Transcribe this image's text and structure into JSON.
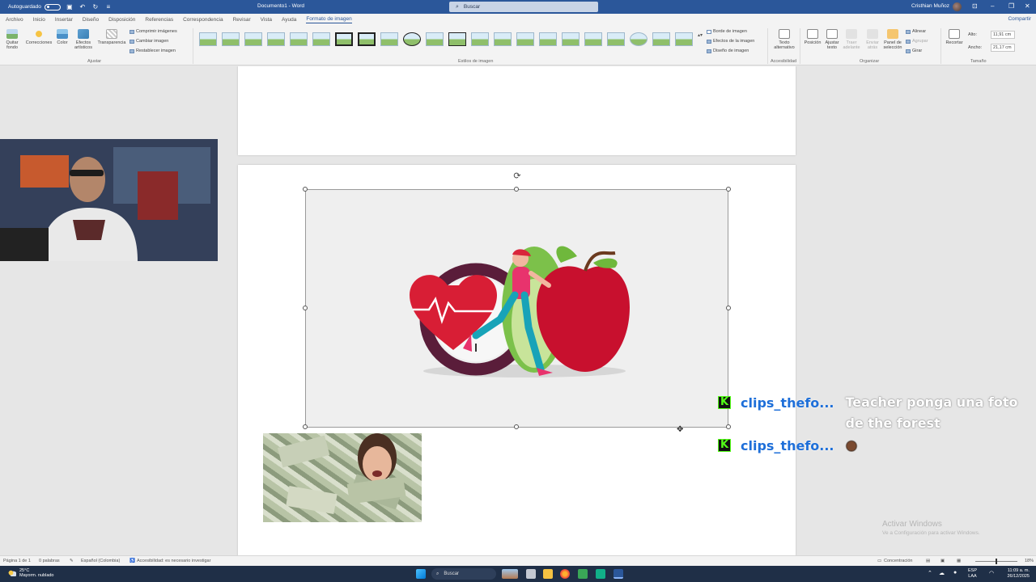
{
  "titlebar": {
    "autosave_label": "Autoguardado",
    "doc_title": "Documento1 - Word",
    "search_placeholder": "Buscar",
    "user_name": "Cristhian Muñoz"
  },
  "tabs": [
    {
      "label": "Archivo"
    },
    {
      "label": "Inicio"
    },
    {
      "label": "Insertar"
    },
    {
      "label": "Diseño"
    },
    {
      "label": "Disposición"
    },
    {
      "label": "Referencias"
    },
    {
      "label": "Correspondencia"
    },
    {
      "label": "Revisar"
    },
    {
      "label": "Vista"
    },
    {
      "label": "Ayuda"
    },
    {
      "label": "Formato de imagen"
    }
  ],
  "share_label": "Compartir",
  "ribbon": {
    "ajustar": {
      "label": "Ajustar",
      "quitar_fondo": "Quitar fondo",
      "correcciones": "Correcciones",
      "color": "Color",
      "efectos": "Efectos artísticos",
      "transparencia": "Transparencia",
      "comprimir": "Comprimir imágenes",
      "cambiar": "Cambiar imagen",
      "restablecer": "Restablecer imagen"
    },
    "estilos": {
      "label": "Estilos de imagen",
      "borde": "Borde de imagen",
      "efectos_imagen": "Efectos de la imagen",
      "diseno": "Diseño de imagen"
    },
    "accesibilidad": {
      "label": "Accesibilidad",
      "texto_alt": "Texto alternativo"
    },
    "organizar": {
      "label": "Organizar",
      "posicion": "Posición",
      "ajustar_texto": "Ajustar texto",
      "traer": "Traer adelante",
      "enviar": "Enviar atrás",
      "panel": "Panel de selección",
      "alinear": "Alinear",
      "agrupar": "Agrupar",
      "girar": "Girar"
    },
    "tamano": {
      "label": "Tamaño",
      "recortar": "Recortar",
      "alto_label": "Alto:",
      "alto_value": "11,91 cm",
      "ancho_label": "Ancho:",
      "ancho_value": "21,17 cm"
    }
  },
  "chat": [
    {
      "user": "clips_thefo...",
      "message": "Teacher ponga una foto de the forest"
    },
    {
      "user": "clips_thefo...",
      "message": ""
    }
  ],
  "watermark": {
    "title": "Activar Windows",
    "subtitle": "Ve a Configuración para activar Windows."
  },
  "statusbar": {
    "page": "Página 1 de 1",
    "words": "0 palabras",
    "language": "Español (Colombia)",
    "accessibility": "Accesibilidad: es necesario investigar",
    "focus": "Concentración",
    "zoom": "18%"
  },
  "taskbar": {
    "temp": "25°C",
    "weather": "Mayorm. nublado",
    "search": "Buscar",
    "lang_top": "ESP",
    "lang_bottom": "LAA",
    "time": "11:09 a. m.",
    "date": "26/12/2025"
  },
  "colors": {
    "word_blue": "#2b579a",
    "kick_green": "#53fc18",
    "chat_user": "#1e6fd9"
  }
}
